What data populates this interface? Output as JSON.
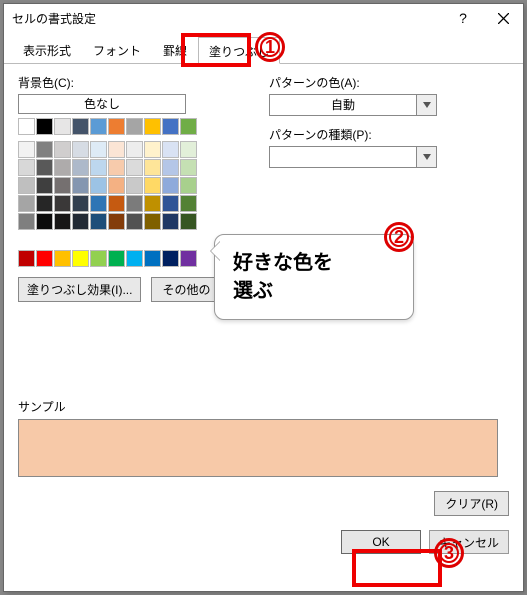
{
  "window": {
    "title": "セルの書式設定",
    "help": "?",
    "close": "×"
  },
  "tabs": {
    "t0": "表示形式",
    "t1": "フォント",
    "t2": "罫線",
    "t3": "塗りつぶし"
  },
  "left": {
    "bg_label": "背景色(C):",
    "no_color": "色なし",
    "fill_effects": "塗りつぶし効果(I)...",
    "more_colors": "その他の"
  },
  "right": {
    "pattern_color_label": "パターンの色(A):",
    "pattern_color_value": "自動",
    "pattern_type_label": "パターンの種類(P):"
  },
  "sample": {
    "label": "サンプル",
    "color": "#f7c9a8"
  },
  "footer": {
    "clear": "クリア(R)",
    "ok": "OK",
    "cancel": "キャンセル"
  },
  "callout": {
    "line1": "好きな色を",
    "line2": "選ぶ"
  },
  "badges": {
    "b1": "1",
    "b2": "2",
    "b3": "3"
  },
  "palette": {
    "theme": [
      "#ffffff",
      "#000000",
      "#e7e6e6",
      "#44546a",
      "#5b9bd5",
      "#ed7d31",
      "#a5a5a5",
      "#ffc000",
      "#4472c4",
      "#70ad47"
    ],
    "tones": [
      [
        "#f2f2f2",
        "#808080",
        "#d0cece",
        "#d6dce4",
        "#deebf6",
        "#fbe5d5",
        "#ededed",
        "#fff2cc",
        "#d9e2f3",
        "#e2efd9"
      ],
      [
        "#d8d8d8",
        "#595959",
        "#aeabab",
        "#adb9ca",
        "#bdd7ee",
        "#f7cbac",
        "#dbdbdb",
        "#fee599",
        "#b4c6e7",
        "#c5e0b3"
      ],
      [
        "#bfbfbf",
        "#3f3f3f",
        "#757070",
        "#8496b0",
        "#9cc3e5",
        "#f4b183",
        "#c9c9c9",
        "#ffd965",
        "#8eaadb",
        "#a8d08d"
      ],
      [
        "#a5a5a5",
        "#262626",
        "#3a3838",
        "#323f4f",
        "#2e75b5",
        "#c55a11",
        "#7b7b7b",
        "#bf9000",
        "#2f5496",
        "#538135"
      ],
      [
        "#7f7f7f",
        "#0c0c0c",
        "#171616",
        "#222a35",
        "#1e4e79",
        "#833c0b",
        "#525252",
        "#7f6000",
        "#1f3864",
        "#375623"
      ]
    ],
    "standard": [
      "#c00000",
      "#ff0000",
      "#ffc000",
      "#ffff00",
      "#92d050",
      "#00b050",
      "#00b0f0",
      "#0070c0",
      "#002060",
      "#7030a0"
    ]
  }
}
